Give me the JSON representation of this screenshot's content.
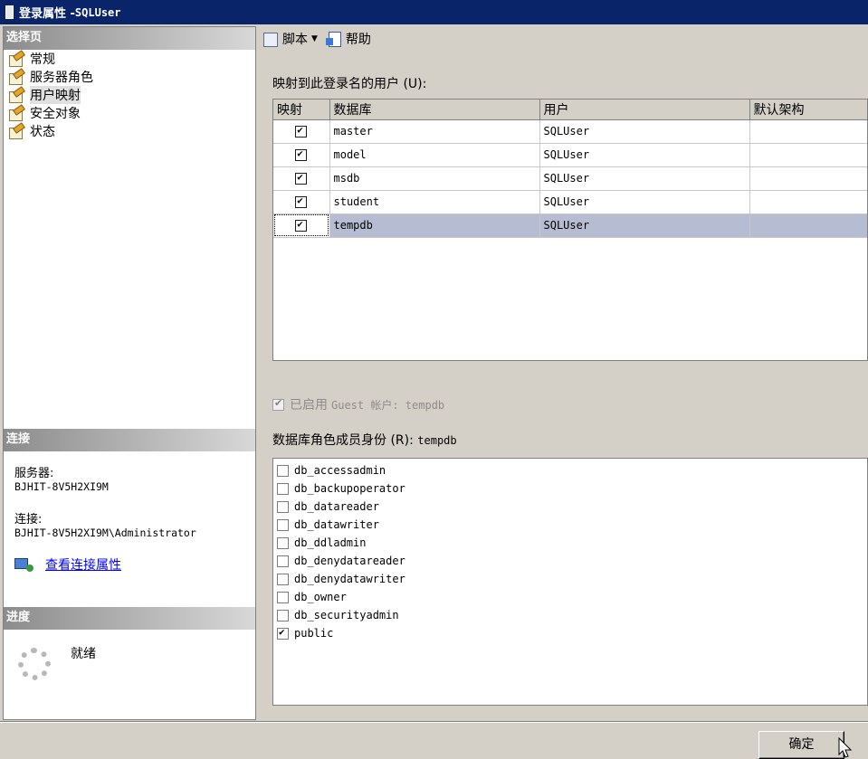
{
  "window": {
    "title_prefix": "登录属性 - ",
    "title_login": "SQLUser"
  },
  "select_page": {
    "header": "选择页",
    "items": [
      {
        "label": "常规",
        "icon": "page-icon",
        "selected": false
      },
      {
        "label": "服务器角色",
        "icon": "page-icon",
        "selected": false
      },
      {
        "label": "用户映射",
        "icon": "page-icon",
        "selected": true
      },
      {
        "label": "安全对象",
        "icon": "page-icon",
        "selected": false
      },
      {
        "label": "状态",
        "icon": "page-icon",
        "selected": false
      }
    ]
  },
  "connection": {
    "header": "连接",
    "server_label": "服务器:",
    "server_value": "BJHIT-8V5H2XI9M",
    "conn_label": "连接:",
    "conn_value": "BJHIT-8V5H2XI9M\\Administrator",
    "link": "查看连接属性"
  },
  "progress": {
    "header": "进度",
    "status": "就绪"
  },
  "toolbar": {
    "script_label": "脚本",
    "help_label": "帮助"
  },
  "mapping": {
    "label": "映射到此登录名的用户",
    "accel": "(U):",
    "columns": [
      "映射",
      "数据库",
      "用户",
      "默认架构"
    ],
    "rows": [
      {
        "mapped": true,
        "database": "master",
        "user": "SQLUser",
        "schema": ""
      },
      {
        "mapped": true,
        "database": "model",
        "user": "SQLUser",
        "schema": ""
      },
      {
        "mapped": true,
        "database": "msdb",
        "user": "SQLUser",
        "schema": ""
      },
      {
        "mapped": true,
        "database": "student",
        "user": "SQLUser",
        "schema": ""
      },
      {
        "mapped": true,
        "database": "tempdb",
        "user": "SQLUser",
        "schema": ""
      }
    ],
    "selected_row": 4
  },
  "guest": {
    "label": "已启用",
    "text": "Guest 帐户: tempdb",
    "checked": true
  },
  "roles": {
    "label": "数据库角色成员身份",
    "accel": "(R):",
    "db": "tempdb",
    "items": [
      {
        "name": "db_accessadmin",
        "checked": false
      },
      {
        "name": "db_backupoperator",
        "checked": false
      },
      {
        "name": "db_datareader",
        "checked": false
      },
      {
        "name": "db_datawriter",
        "checked": false
      },
      {
        "name": "db_ddladmin",
        "checked": false
      },
      {
        "name": "db_denydatareader",
        "checked": false
      },
      {
        "name": "db_denydatawriter",
        "checked": false
      },
      {
        "name": "db_owner",
        "checked": false
      },
      {
        "name": "db_securityadmin",
        "checked": false
      },
      {
        "name": "public",
        "checked": true
      }
    ]
  },
  "buttons": {
    "ok": "确定"
  },
  "colors": {
    "titlebar": "#0a246a",
    "selected_row": "#b6bdd2",
    "dialog_bg": "#d4d0c8",
    "link": "#0000ff"
  }
}
